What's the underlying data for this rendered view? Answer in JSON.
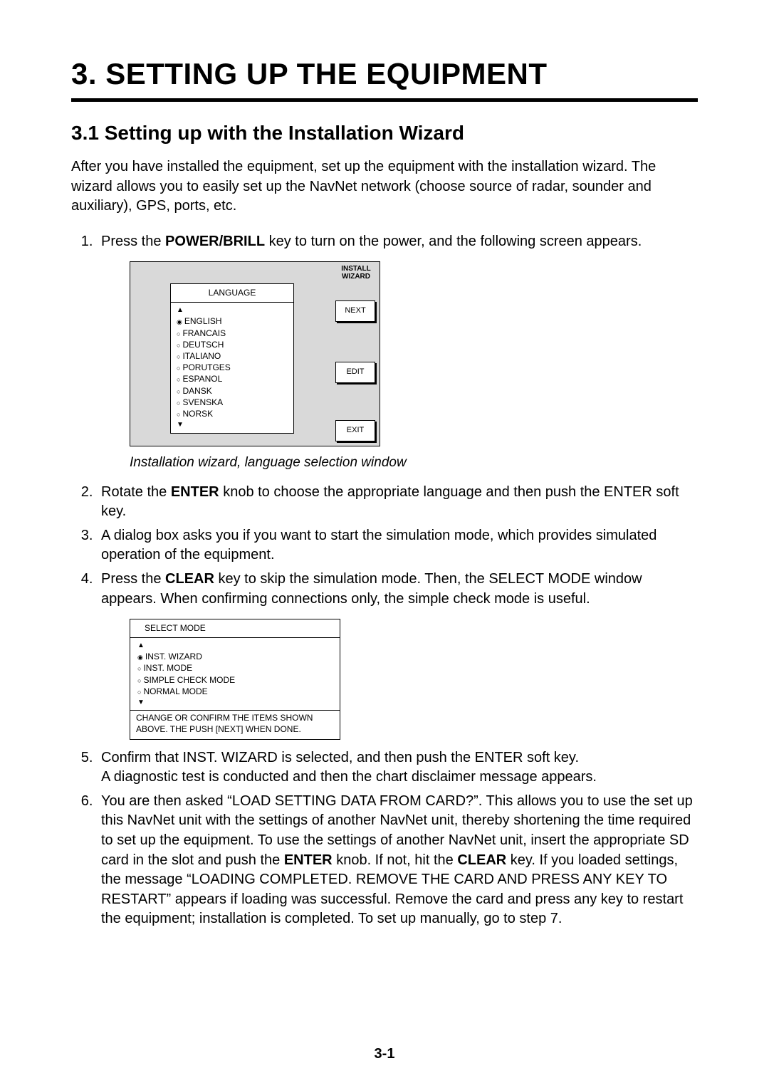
{
  "chapter": "3.  SETTING UP THE EQUIPMENT",
  "section": "3.1   Setting up with the Installation Wizard",
  "intro": "After you have installed the equipment, set up the equipment with the installation wizard. The wizard allows you to easily set up the NavNet network (choose source of radar, sounder and auxiliary), GPS, ports, etc.",
  "steps": {
    "s1_a": "Press the ",
    "s1_bold": "POWER/BRILL",
    "s1_b": " key to turn on the power, and the following screen appears.",
    "s2_a": "Rotate the ",
    "s2_bold": "ENTER",
    "s2_b": " knob to choose the appropriate language and then push the ENTER soft key.",
    "s3": "A dialog box asks you if you want to start the simulation mode, which provides simulated operation of the equipment.",
    "s4_a": "Press the ",
    "s4_bold": "CLEAR",
    "s4_b": " key to skip the simulation mode. Then, the SELECT MODE window appears. When confirming connections only, the simple check mode is useful.",
    "s5_a": "Confirm that INST. WIZARD is selected, and then push the ENTER soft key.",
    "s5_b": "A diagnostic test is conducted and then the chart disclaimer message appears.",
    "s6_a": "You are then asked “LOAD SETTING DATA FROM CARD?”. This allows you to use the set up this NavNet unit with the settings of another NavNet unit, thereby shortening the time required to set up the equipment. To use the settings of another NavNet unit, insert the appropriate SD card in the slot and push the ",
    "s6_bold1": "ENTER",
    "s6_b": " knob. If not, hit the ",
    "s6_bold2": "CLEAR",
    "s6_c": " key. If you loaded settings, the message “LOADING COMPLETED. REMOVE THE CARD AND PRESS ANY KEY TO RESTART” appears if loading was successful. Remove the card and press any key to restart the equipment; installation is completed. To set up manually, go to step 7."
  },
  "fig1": {
    "title": "LANGUAGE",
    "options": [
      "ENGLISH",
      "FRANCAIS",
      "DEUTSCH",
      "ITALIANO",
      "PORUTGES",
      "ESPANOL",
      "DANSK",
      "SVENSKA",
      "NORSK"
    ],
    "selected_index": 0,
    "side_label_1": "INSTALL",
    "side_label_2": "WIZARD",
    "btn_next": "NEXT",
    "btn_edit": "EDIT",
    "btn_exit": "EXIT"
  },
  "caption1": "Installation wizard, language selection window",
  "fig2": {
    "title": "SELECT MODE",
    "options": [
      "INST. WIZARD",
      "INST. MODE",
      "SIMPLE CHECK MODE",
      "NORMAL MODE"
    ],
    "selected_index": 0,
    "msg1": "CHANGE OR CONFIRM THE ITEMS SHOWN",
    "msg2": "ABOVE. THE PUSH [NEXT] WHEN DONE."
  },
  "page_number": "3-1"
}
